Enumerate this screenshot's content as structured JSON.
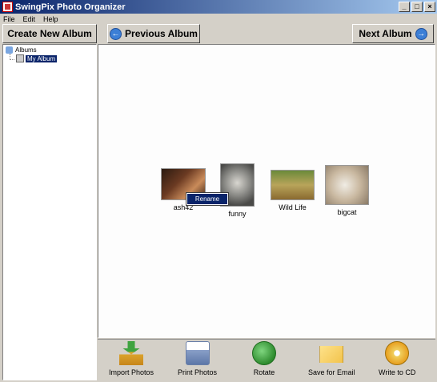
{
  "window": {
    "title": "SwingPix Photo Organizer"
  },
  "menu": [
    "File",
    "Edit",
    "Help"
  ],
  "toolbar": {
    "create_label": "Create New Album",
    "prev_label": "Previous Album",
    "next_label": "Next Album"
  },
  "tree": {
    "root_label": "Albums",
    "child_label": "My Album"
  },
  "photos": [
    {
      "label": "ash42"
    },
    {
      "label": "funny"
    },
    {
      "label": "Wild Life"
    },
    {
      "label": "bigcat"
    }
  ],
  "context_menu": {
    "item": "Rename"
  },
  "bottom_tools": [
    {
      "label": "Import Photos",
      "icon": "import-photos-icon"
    },
    {
      "label": "Print Photos",
      "icon": "printer-icon"
    },
    {
      "label": "Rotate",
      "icon": "rotate-icon"
    },
    {
      "label": "Save for Email",
      "icon": "email-envelope-icon"
    },
    {
      "label": "Write to CD",
      "icon": "cd-disc-icon"
    }
  ],
  "colors": {
    "titlebar": "#0a246a",
    "selection": "#0a246a",
    "face": "#d4d0c8"
  }
}
